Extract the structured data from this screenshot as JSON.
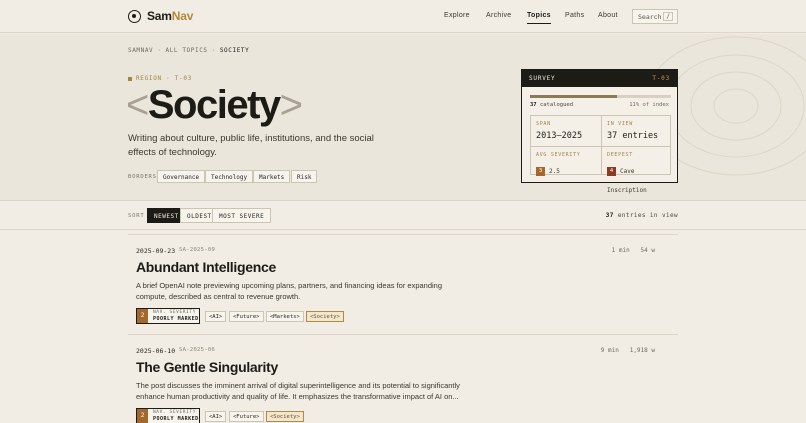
{
  "header": {
    "logo_sam": "Sam",
    "logo_nav": "Nav",
    "nav": [
      {
        "label": "Explore",
        "active": false
      },
      {
        "label": "Archive",
        "active": false
      },
      {
        "label": "Topics",
        "active": true
      },
      {
        "label": "Paths",
        "active": false
      },
      {
        "label": "About",
        "active": false
      }
    ],
    "search_label": "Search",
    "search_key": "/"
  },
  "hero": {
    "breadcrumb": [
      "SAMNAV",
      "ALL TOPICS",
      "SOCIETY"
    ],
    "eyebrow": "REGION · T-03",
    "title_open": "<",
    "title": "Society",
    "title_close": ">",
    "description": "Writing about culture, public life, institutions, and the social effects of technology.",
    "borders_label": "BORDERS",
    "borders": [
      "Governance",
      "Technology",
      "Markets",
      "Risk"
    ]
  },
  "survey": {
    "title": "SURVEY",
    "code": "T-03",
    "progress": 0.62,
    "catalogued_count": "37",
    "catalogued_label": "catalogued",
    "index_share": "11% of index",
    "span_label": "SPAN",
    "span_value": "2013–2025",
    "in_view_label": "IN VIEW",
    "in_view_value": "37 entries",
    "avg_label": "AVG SEVERITY",
    "avg_badge": "3",
    "avg_value": "2.5",
    "deepest_label": "DEEPEST",
    "deepest_badge": "4",
    "deepest_value": "Cave Inscription",
    "colors": {
      "avg": "#a5682c",
      "deepest": "#8a3d26"
    }
  },
  "sort": {
    "label": "SORT",
    "options": [
      {
        "label": "NEWEST",
        "active": true
      },
      {
        "label": "OLDEST",
        "active": false
      },
      {
        "label": "MOST SEVERE",
        "active": false
      }
    ],
    "count": "37",
    "count_label": "entries in view"
  },
  "entries": [
    {
      "date": "2025-09-23",
      "id": "SA-2025-09",
      "read": "1 min",
      "words": "54 w",
      "title": "Abundant Intelligence",
      "summary": "A brief OpenAI note previewing upcoming plans, partners, and financing ideas for expanding compute, described as central to revenue growth.",
      "severity": "2",
      "sev_label": "NAV. SEVERITY",
      "sev_text": "POORLY MARKED",
      "tags": [
        {
          "label": "<AI>",
          "hl": false
        },
        {
          "label": "<Future>",
          "hl": false
        },
        {
          "label": "<Markets>",
          "hl": false
        },
        {
          "label": "<Society>",
          "hl": true
        }
      ]
    },
    {
      "date": "2025-06-10",
      "id": "SA-2025-06",
      "read": "9 min",
      "words": "1,918 w",
      "title": "The Gentle Singularity",
      "summary": "The post discusses the imminent arrival of digital superintelligence and its potential to significantly enhance human productivity and quality of life. It emphasizes the transformative impact of AI on...",
      "severity": "2",
      "sev_label": "NAV. SEVERITY",
      "sev_text": "POORLY MARKED",
      "tags": [
        {
          "label": "<AI>",
          "hl": false
        },
        {
          "label": "<Future>",
          "hl": false
        },
        {
          "label": "<Society>",
          "hl": true
        }
      ]
    }
  ]
}
